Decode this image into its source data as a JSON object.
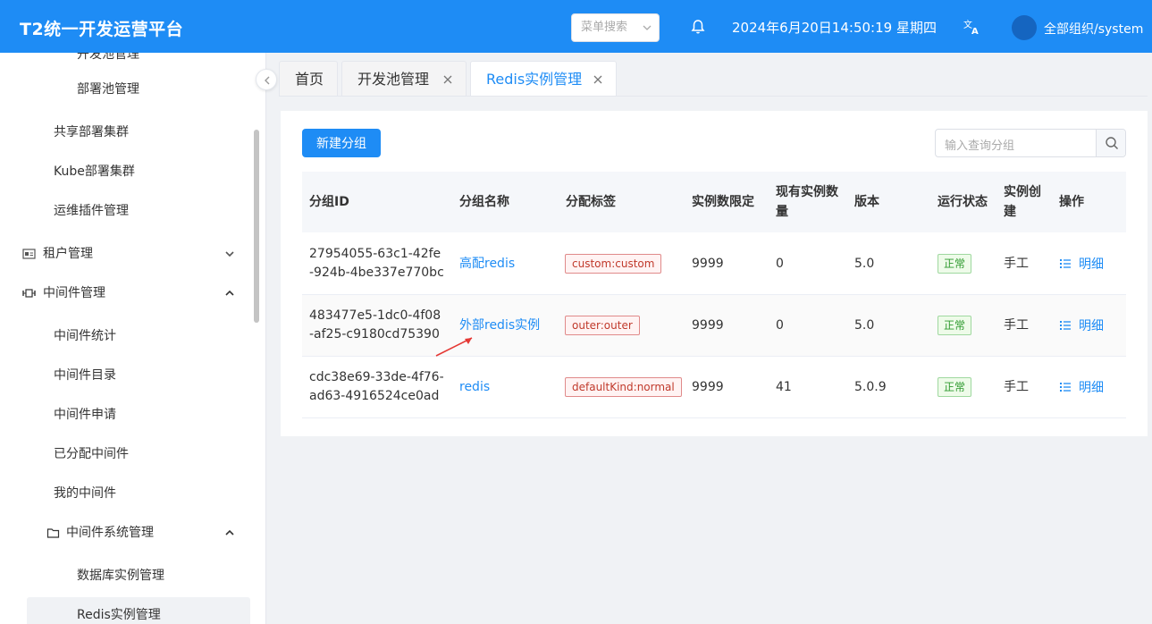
{
  "header": {
    "title": "T2统一开发运营平台",
    "menu_search_placeholder": "菜单搜索",
    "datetime": "2024年6月20日14:50:19 星期四",
    "user": "全部组织/system",
    "bg_color": "#1e8cf5"
  },
  "sidebar": {
    "items": [
      {
        "label": "开发池管理",
        "level": 3
      },
      {
        "label": "部署池管理",
        "level": 3
      },
      {
        "label": "共享部署集群",
        "level": 2
      },
      {
        "label": "Kube部署集群",
        "level": 2
      },
      {
        "label": "运维插件管理",
        "level": 2
      },
      {
        "label": "租户管理",
        "level": 1,
        "icon": "id-card-icon",
        "expanded": false
      },
      {
        "label": "中间件管理",
        "level": 1,
        "icon": "middleware-icon",
        "expanded": true
      },
      {
        "label": "中间件统计",
        "level": 2
      },
      {
        "label": "中间件目录",
        "level": 2
      },
      {
        "label": "中间件申请",
        "level": 2
      },
      {
        "label": "已分配中间件",
        "level": 2
      },
      {
        "label": "我的中间件",
        "level": 2
      },
      {
        "label": "中间件系统管理",
        "level": 2,
        "icon": "folder-icon",
        "expanded": true
      },
      {
        "label": "数据库实例管理",
        "level": 3
      },
      {
        "label": "Redis实例管理",
        "level": 3,
        "active": true
      }
    ]
  },
  "tabs": [
    {
      "label": "首页",
      "closable": false
    },
    {
      "label": "开发池管理",
      "closable": true
    },
    {
      "label": "Redis实例管理",
      "closable": true,
      "active": true
    }
  ],
  "toolbar": {
    "new_group_label": "新建分组",
    "search_placeholder": "输入查询分组"
  },
  "table": {
    "headers": [
      "分组ID",
      "分组名称",
      "分配标签",
      "实例数限定",
      "现有实例数量",
      "版本",
      "运行状态",
      "实例创建",
      "操作"
    ],
    "rows": [
      {
        "id": "27954055-63c1-42fe-924b-4be337e770bc",
        "name": "高配redis",
        "tag": "custom:custom",
        "limit": "9999",
        "count": "0",
        "version": "5.0",
        "status": "正常",
        "create": "手工",
        "op": "明细"
      },
      {
        "id": "483477e5-1dc0-4f08-af25-c9180cd75390",
        "name": "外部redis实例",
        "tag": "outer:outer",
        "limit": "9999",
        "count": "0",
        "version": "5.0",
        "status": "正常",
        "create": "手工",
        "op": "明细"
      },
      {
        "id": "cdc38e69-33de-4f76-ad63-4916524ce0ad",
        "name": "redis",
        "tag": "defaultKind:normal",
        "limit": "9999",
        "count": "41",
        "version": "5.0.9",
        "status": "正常",
        "create": "手工",
        "op": "明细"
      }
    ]
  }
}
